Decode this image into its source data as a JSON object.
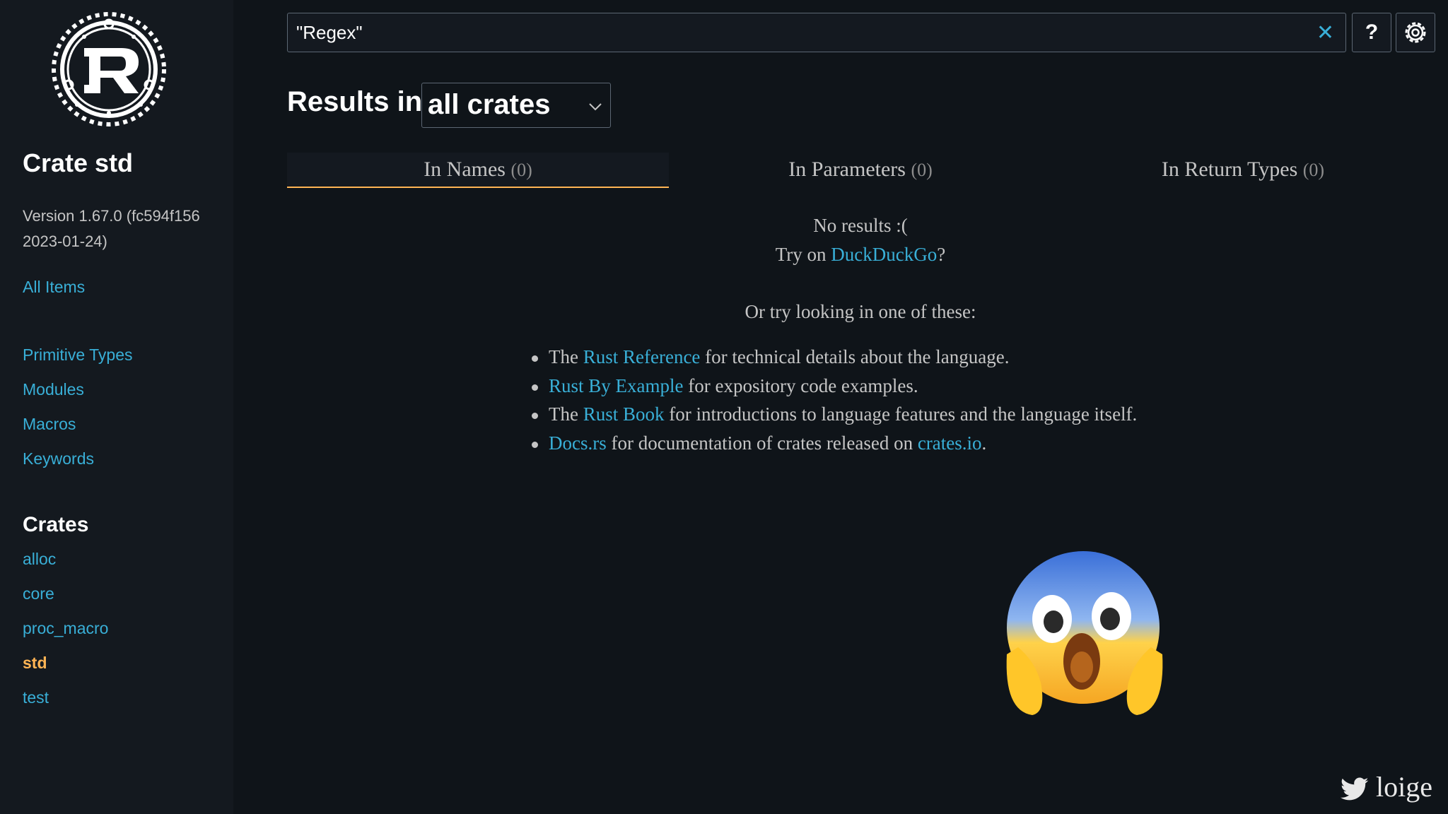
{
  "sidebar": {
    "logo": "rust-logo",
    "crate_title": "Crate std",
    "version": "Version 1.67.0 (fc594f156 2023-01-24)",
    "all_items": "All Items",
    "sections": [
      "Primitive Types",
      "Modules",
      "Macros",
      "Keywords"
    ],
    "crates_heading": "Crates",
    "crates": [
      "alloc",
      "core",
      "proc_macro",
      "std",
      "test"
    ],
    "current_crate": "std"
  },
  "search": {
    "value": "\"Regex\"",
    "clear_icon": "close-icon",
    "help_label": "?",
    "settings_icon": "gear-icon"
  },
  "results": {
    "heading": "Results in",
    "crate_filter": "all crates",
    "tabs": [
      {
        "label": "In Names",
        "count": "(0)",
        "selected": true
      },
      {
        "label": "In Parameters",
        "count": "(0)",
        "selected": false
      },
      {
        "label": "In Return Types",
        "count": "(0)",
        "selected": false
      }
    ],
    "no_results": "No results :(",
    "try_on_prefix": "Try on ",
    "try_on_link": "DuckDuckGo",
    "try_on_suffix": "?",
    "or_try": "Or try looking in one of these:",
    "suggestions": [
      {
        "pre": "The ",
        "link": "Rust Reference",
        "post": " for technical details about the language."
      },
      {
        "pre": "",
        "link": "Rust By Example",
        "post": " for expository code examples."
      },
      {
        "pre": "The ",
        "link": "Rust Book",
        "post": " for introductions to language features and the language itself."
      },
      {
        "pre": "",
        "link": "Docs.rs",
        "post": " for documentation of crates released on ",
        "link2": "crates.io",
        "post2": "."
      }
    ]
  },
  "overlay": {
    "emoji": "screaming-face-emoji",
    "watermark_text": "loige",
    "watermark_icon": "twitter-bird-icon"
  },
  "colors": {
    "background": "#0f1419",
    "sidebar": "#14191f",
    "link": "#39afd7",
    "accent": "#ffb454",
    "text": "#c5c5c5"
  }
}
